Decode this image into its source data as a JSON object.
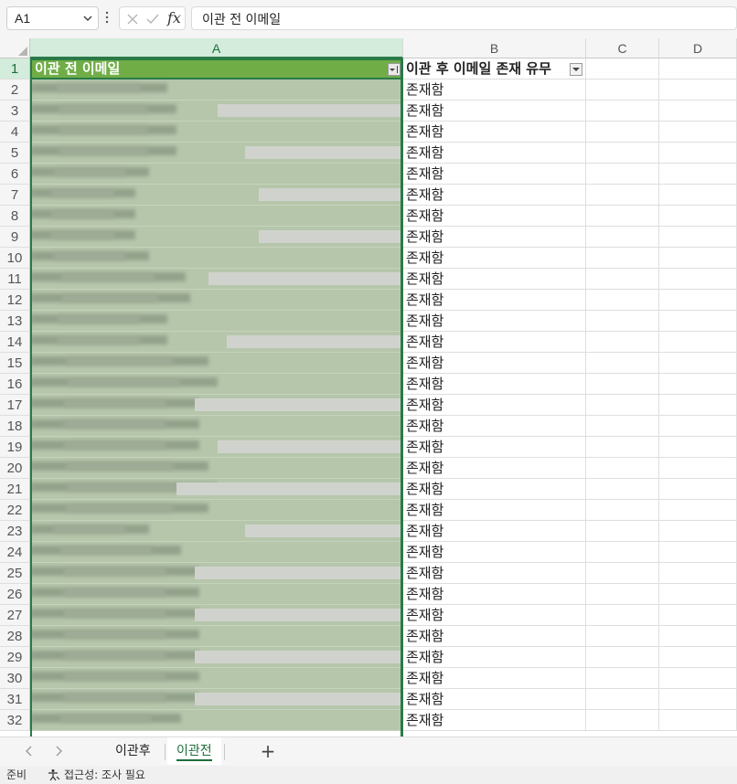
{
  "formula_bar": {
    "name_box": "A1",
    "formula": "이관 전 이메일"
  },
  "columns": [
    "A",
    "B",
    "C",
    "D"
  ],
  "header_row": {
    "row_number": "1",
    "a": "이관 전 이메일",
    "b": "이관 후 이메일 존재 유무"
  },
  "rows": [
    {
      "n": "2",
      "b": "존재함"
    },
    {
      "n": "3",
      "b": "존재함"
    },
    {
      "n": "4",
      "b": "존재함"
    },
    {
      "n": "5",
      "b": "존재함"
    },
    {
      "n": "6",
      "b": "존재함"
    },
    {
      "n": "7",
      "b": "존재함"
    },
    {
      "n": "8",
      "b": "존재함"
    },
    {
      "n": "9",
      "b": "존재함"
    },
    {
      "n": "10",
      "b": "존재함"
    },
    {
      "n": "11",
      "b": "존재함"
    },
    {
      "n": "12",
      "b": "존재함"
    },
    {
      "n": "13",
      "b": "존재함"
    },
    {
      "n": "14",
      "b": "존재함"
    },
    {
      "n": "15",
      "b": "존재함"
    },
    {
      "n": "16",
      "b": "존재함"
    },
    {
      "n": "17",
      "b": "존재함"
    },
    {
      "n": "18",
      "b": "존재함"
    },
    {
      "n": "19",
      "b": "존재함"
    },
    {
      "n": "20",
      "b": "존재함"
    },
    {
      "n": "21",
      "b": "존재함"
    },
    {
      "n": "22",
      "b": "존재함"
    },
    {
      "n": "23",
      "b": "존재함"
    },
    {
      "n": "24",
      "b": "존재함"
    },
    {
      "n": "25",
      "b": "존재함"
    },
    {
      "n": "26",
      "b": "존재함"
    },
    {
      "n": "27",
      "b": "존재함"
    },
    {
      "n": "28",
      "b": "존재함"
    },
    {
      "n": "29",
      "b": "존재함"
    },
    {
      "n": "30",
      "b": "존재함"
    },
    {
      "n": "31",
      "b": "존재함"
    },
    {
      "n": "32",
      "b": "존재함"
    }
  ],
  "sheet_tabs": [
    {
      "label": "이관후",
      "active": false
    },
    {
      "label": "이관전",
      "active": true
    }
  ],
  "status_bar": {
    "ready": "준비",
    "accessibility": "접근성: 조사 필요"
  },
  "colors": {
    "header_fill": "#70ad47",
    "selection": "#2a7a48",
    "redacted_fill": "#b6c6ab"
  }
}
